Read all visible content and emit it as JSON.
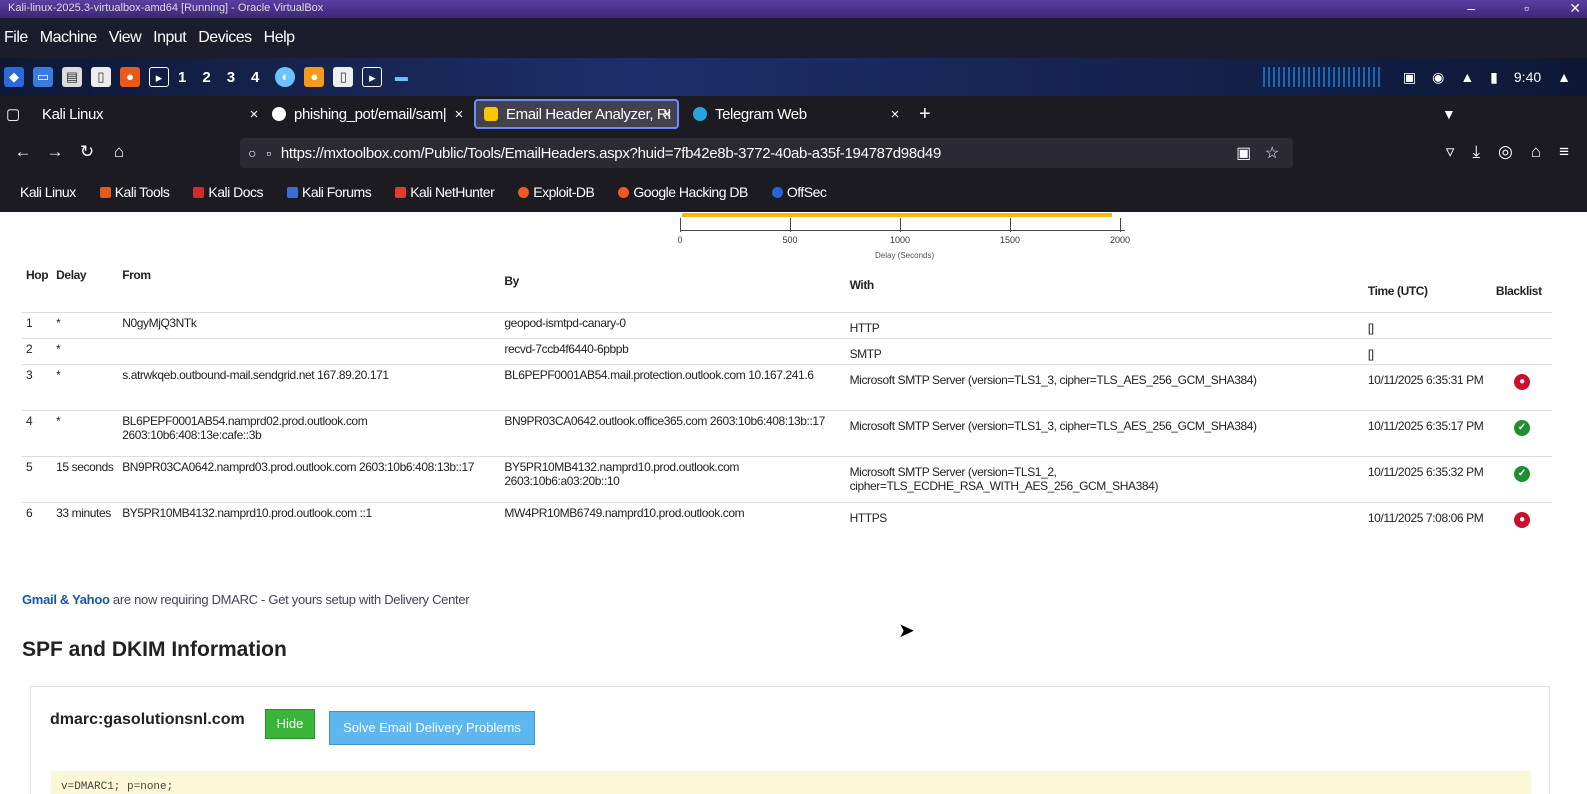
{
  "window": {
    "title": "Kali-linux-2025.3-virtualbox-amd64 [Running] - Oracle VirtualBox",
    "controls": [
      "–",
      "▫",
      "✕"
    ]
  },
  "vm_menu": [
    "File",
    "Machine",
    "View",
    "Input",
    "Devices",
    "Help"
  ],
  "taskbar": {
    "workspaces": [
      "1",
      "2",
      "3",
      "4"
    ],
    "clock": "9:40"
  },
  "tabs": [
    {
      "label": "Kali Linux",
      "color": "#e6e6e6"
    },
    {
      "label": "phishing_pot/email/sam|",
      "color": "#ffffff"
    },
    {
      "label": "Email Header Analyzer, RI",
      "color": "#f7c600"
    },
    {
      "label": "Telegram Web",
      "color": "#2aa3e0"
    }
  ],
  "new_tab": "+",
  "url": "https://mxtoolbox.com/Public/Tools/EmailHeaders.aspx?huid=7fb42e8b-3772-40ab-a35f-194787d98d49",
  "bookmarks": [
    {
      "label": "Kali Linux",
      "color": "#2b78d4"
    },
    {
      "label": "Kali Tools",
      "color": "#e55a1b"
    },
    {
      "label": "Kali Docs",
      "color": "#d12b2b"
    },
    {
      "label": "Kali Forums",
      "color": "#3a6fd8"
    },
    {
      "label": "Kali NetHunter",
      "color": "#e33a2b"
    },
    {
      "label": "Exploit-DB",
      "color": "#f05a22"
    },
    {
      "label": "Google Hacking DB",
      "color": "#f05a22"
    },
    {
      "label": "OffSec",
      "color": "#2a62d9"
    }
  ],
  "chart_data": {
    "type": "bar",
    "xlim": [
      0,
      2000
    ],
    "ticks": [
      "0",
      "500",
      "1000",
      "1500",
      "2000"
    ],
    "xlabel": "Delay (Seconds)",
    "bar_color": "#f3b90c"
  },
  "table": {
    "headers": [
      "Hop",
      "Delay",
      "From",
      "By",
      "With",
      "Time (UTC)",
      "Blacklist"
    ],
    "rows": [
      {
        "hop": "1",
        "delay": "*",
        "from": "N0gyMjQ3NTk",
        "by": "geopod-ismtpd-canary-0",
        "with": "HTTP",
        "time": "[]",
        "bl": ""
      },
      {
        "hop": "2",
        "delay": "*",
        "from": "",
        "by": "recvd-7ccb4f6440-6pbpb",
        "with": "SMTP",
        "time": "[]",
        "bl": ""
      },
      {
        "hop": "3",
        "delay": "*",
        "from": "s.atrwkqeb.outbound-mail.sendgrid.net 167.89.20.171",
        "by": "BL6PEPF0001AB54.mail.protection.outlook.com 10.167.241.6",
        "with": "Microsoft SMTP Server (version=TLS1_3, cipher=TLS_AES_256_GCM_SHA384)",
        "time": "10/11/2025 6:35:31 PM",
        "bl": "red"
      },
      {
        "hop": "4",
        "delay": "*",
        "from": "BL6PEPF0001AB54.namprd02.prod.outlook.com 2603:10b6:408:13e:cafe::3b",
        "by": "BN9PR03CA0642.outlook.office365.com 2603:10b6:408:13b::17",
        "with": "Microsoft SMTP Server (version=TLS1_3, cipher=TLS_AES_256_GCM_SHA384)",
        "time": "10/11/2025 6:35:17 PM",
        "bl": "green"
      },
      {
        "hop": "5",
        "delay": "15 seconds",
        "from": "BN9PR03CA0642.namprd03.prod.outlook.com 2603:10b6:408:13b::17",
        "by": "BY5PR10MB4132.namprd10.prod.outlook.com 2603:10b6:a03:20b::10",
        "with": "Microsoft SMTP Server (version=TLS1_2, cipher=TLS_ECDHE_RSA_WITH_AES_256_GCM_SHA384)",
        "time": "10/11/2025 6:35:32 PM",
        "bl": "green"
      },
      {
        "hop": "6",
        "delay": "33 minutes",
        "from": "BY5PR10MB4132.namprd10.prod.outlook.com ::1",
        "by": "MW4PR10MB6749.namprd10.prod.outlook.com",
        "with": "HTTPS",
        "time": "10/11/2025 7:08:06 PM",
        "bl": "red"
      }
    ]
  },
  "promo": {
    "brand": "Gmail & Yahoo",
    "text": " are now requiring DMARC - Get yours setup with Delivery Center"
  },
  "section_title": "SPF and DKIM Information",
  "dmarc": {
    "label": "dmarc:gasolutionsnl.com",
    "hide": "Hide",
    "solve": "Solve Email Delivery Problems",
    "record": "v=DMARC1; p=none;"
  }
}
